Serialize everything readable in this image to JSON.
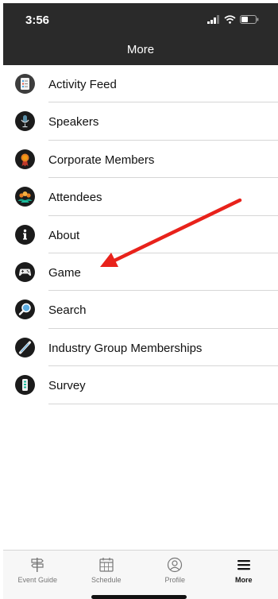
{
  "status_bar": {
    "time": "3:56"
  },
  "header": {
    "title": "More"
  },
  "menu": {
    "items": [
      {
        "label": "Activity Feed",
        "icon": "activity-feed-icon"
      },
      {
        "label": "Speakers",
        "icon": "microphone-icon"
      },
      {
        "label": "Corporate Members",
        "icon": "ribbon-badge-icon"
      },
      {
        "label": "Attendees",
        "icon": "attendees-icon"
      },
      {
        "label": "About",
        "icon": "info-icon"
      },
      {
        "label": "Game",
        "icon": "gamepad-icon"
      },
      {
        "label": "Search",
        "icon": "magnifier-icon"
      },
      {
        "label": "Industry Group Memberships",
        "icon": "industry-group-icon"
      },
      {
        "label": "Survey",
        "icon": "survey-icon"
      }
    ]
  },
  "annotation": {
    "color": "#e8221b",
    "points_to": "Game"
  },
  "tab_bar": {
    "items": [
      {
        "label": "Event Guide",
        "icon": "signpost-icon"
      },
      {
        "label": "Schedule",
        "icon": "calendar-icon"
      },
      {
        "label": "Profile",
        "icon": "profile-icon"
      },
      {
        "label": "More",
        "icon": "menu-icon",
        "active": true
      }
    ]
  }
}
